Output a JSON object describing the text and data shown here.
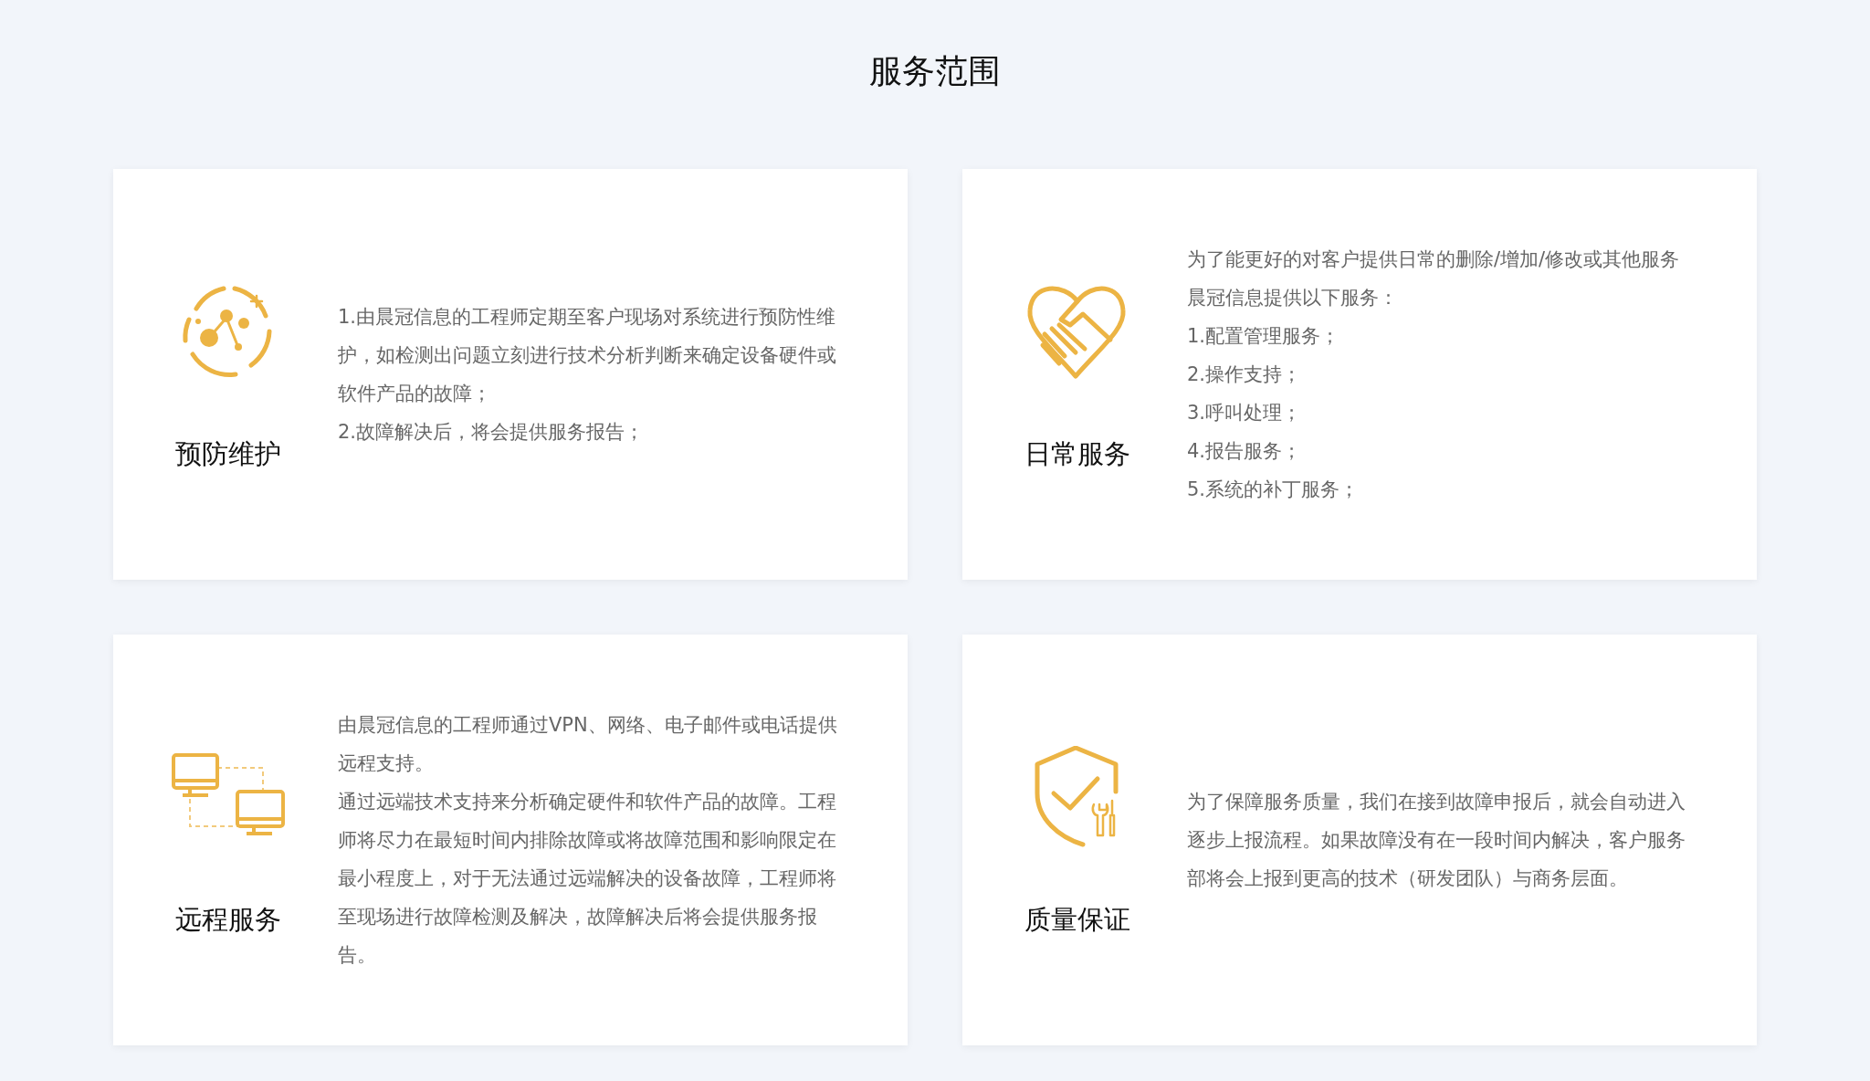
{
  "title": "服务范围",
  "cards": [
    {
      "kind": "network",
      "title": "预防维护",
      "paragraphs": [
        "1.由晨冠信息的工程师定期至客户现场对系统进行预防性维护，如检测出问题立刻进行技术分析判断来确定设备硬件或软件产品的故障；",
        "2.故障解决后，将会提供服务报告；"
      ]
    },
    {
      "kind": "handshake",
      "title": "日常服务",
      "paragraphs": [
        "为了能更好的对客户提供日常的删除/增加/修改或其他服务晨冠信息提供以下服务：",
        "1.配置管理服务；",
        "2.操作支持；",
        "3.呼叫处理；",
        "4.报告服务；",
        "5.系统的补丁服务；"
      ]
    },
    {
      "kind": "monitors",
      "title": "远程服务",
      "paragraphs": [
        "由晨冠信息的工程师通过VPN、网络、电子邮件或电话提供远程支持。",
        "通过远端技术支持来分析确定硬件和软件产品的故障。工程师将尽力在最短时间内排除故障或将故障范围和影响限定在最小程度上，对于无法通过远端解决的设备故障，工程师将至现场进行故障检测及解决，故障解决后将会提供服务报告。"
      ]
    },
    {
      "kind": "shield",
      "title": "质量保证",
      "paragraphs": [
        "为了保障服务质量，我们在接到故障申报后，就会自动进入逐步上报流程。如果故障没有在一段时间内解决，客户服务部将会上报到更高的技术（研发团队）与商务层面。"
      ]
    }
  ]
}
